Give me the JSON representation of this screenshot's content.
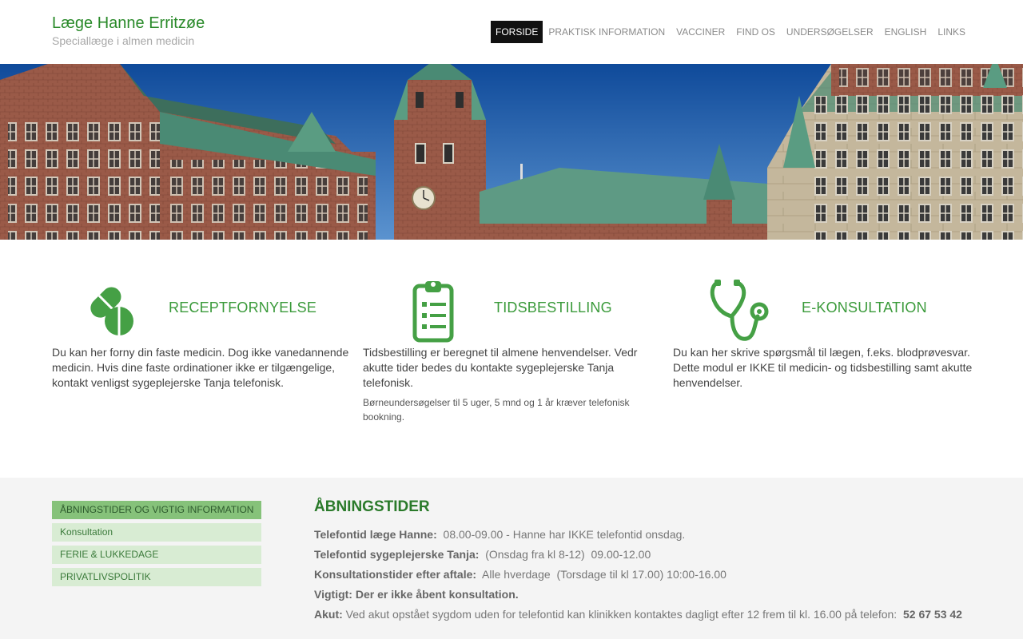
{
  "header": {
    "title": "Læge Hanne Erritzøe",
    "subtitle": "Speciallæge i almen medicin",
    "nav": [
      "FORSIDE",
      "PRAKTISK INFORMATION",
      "VACCINER",
      "FIND OS",
      "UNDERSØGELSER",
      "ENGLISH",
      "LINKS"
    ],
    "active_nav": "FORSIDE"
  },
  "hero": {
    "alt": "castle-photo"
  },
  "services": [
    {
      "icon": "pills-icon",
      "title": "RECEPTFORNYELSE",
      "text": "Du kan her forny din faste medicin. Dog ikke vanedannende medicin. Hvis dine faste ordinationer ikke er tilgængelige, kontakt venligst sygeplejerske Tanja telefonisk.",
      "note": ""
    },
    {
      "icon": "clipboard-icon",
      "title": "TIDSBESTILLING",
      "text": "Tidsbestilling er beregnet til almene henvendelser. Vedr akutte tider bedes du kontakte sygeplejerske Tanja telefonisk.",
      "note": "Børneundersøgelser til 5 uger, 5 mnd og 1 år kræver telefonisk bookning."
    },
    {
      "icon": "stethoscope-icon",
      "title": "E-KONSULTATION",
      "text": "Du kan her skrive spørgsmål til lægen, f.eks. blodprøvesvar. Dette modul er IKKE til medicin- og tidsbestilling samt akutte henvendelser.",
      "note": ""
    }
  ],
  "side_menu": [
    "ÅBNINGSTIDER OG VIGTIG INFORMATION",
    "Konsultation",
    "FERIE & LUKKEDAGE",
    "PRIVATLIVSPOLITIK"
  ],
  "info": {
    "title": "ÅBNINGSTIDER",
    "lines": [
      {
        "label": "Telefontid læge Hanne:",
        "text": "08.00-09.00 - Hanne har IKKE telefontid onsdag."
      },
      {
        "label": "Telefontid sygeplejerske Tanja:",
        "text": "(Onsdag fra kl 8-12)  09.00-12.00"
      },
      {
        "label": "Konsultationstider efter aftale:",
        "text": "Alle hverdage  (Torsdage til kl 17.00) 10:00-16.00"
      },
      {
        "label": "Vigtigt: Der er ikke åbent konsultation.",
        "text": ""
      },
      {
        "label": "Akut:",
        "text": "Ved akut opstået sygdom uden for telefontid kan klinikken kontaktes dagligt efter 12 frem til kl. 16.00 på telefon:",
        "phone": "52 67 53 42"
      }
    ]
  },
  "colors": {
    "brand_green": "#2a8a2a",
    "accent_green": "#3a9a3a",
    "icon_green": "#45a045",
    "nav_active": "#111111"
  }
}
